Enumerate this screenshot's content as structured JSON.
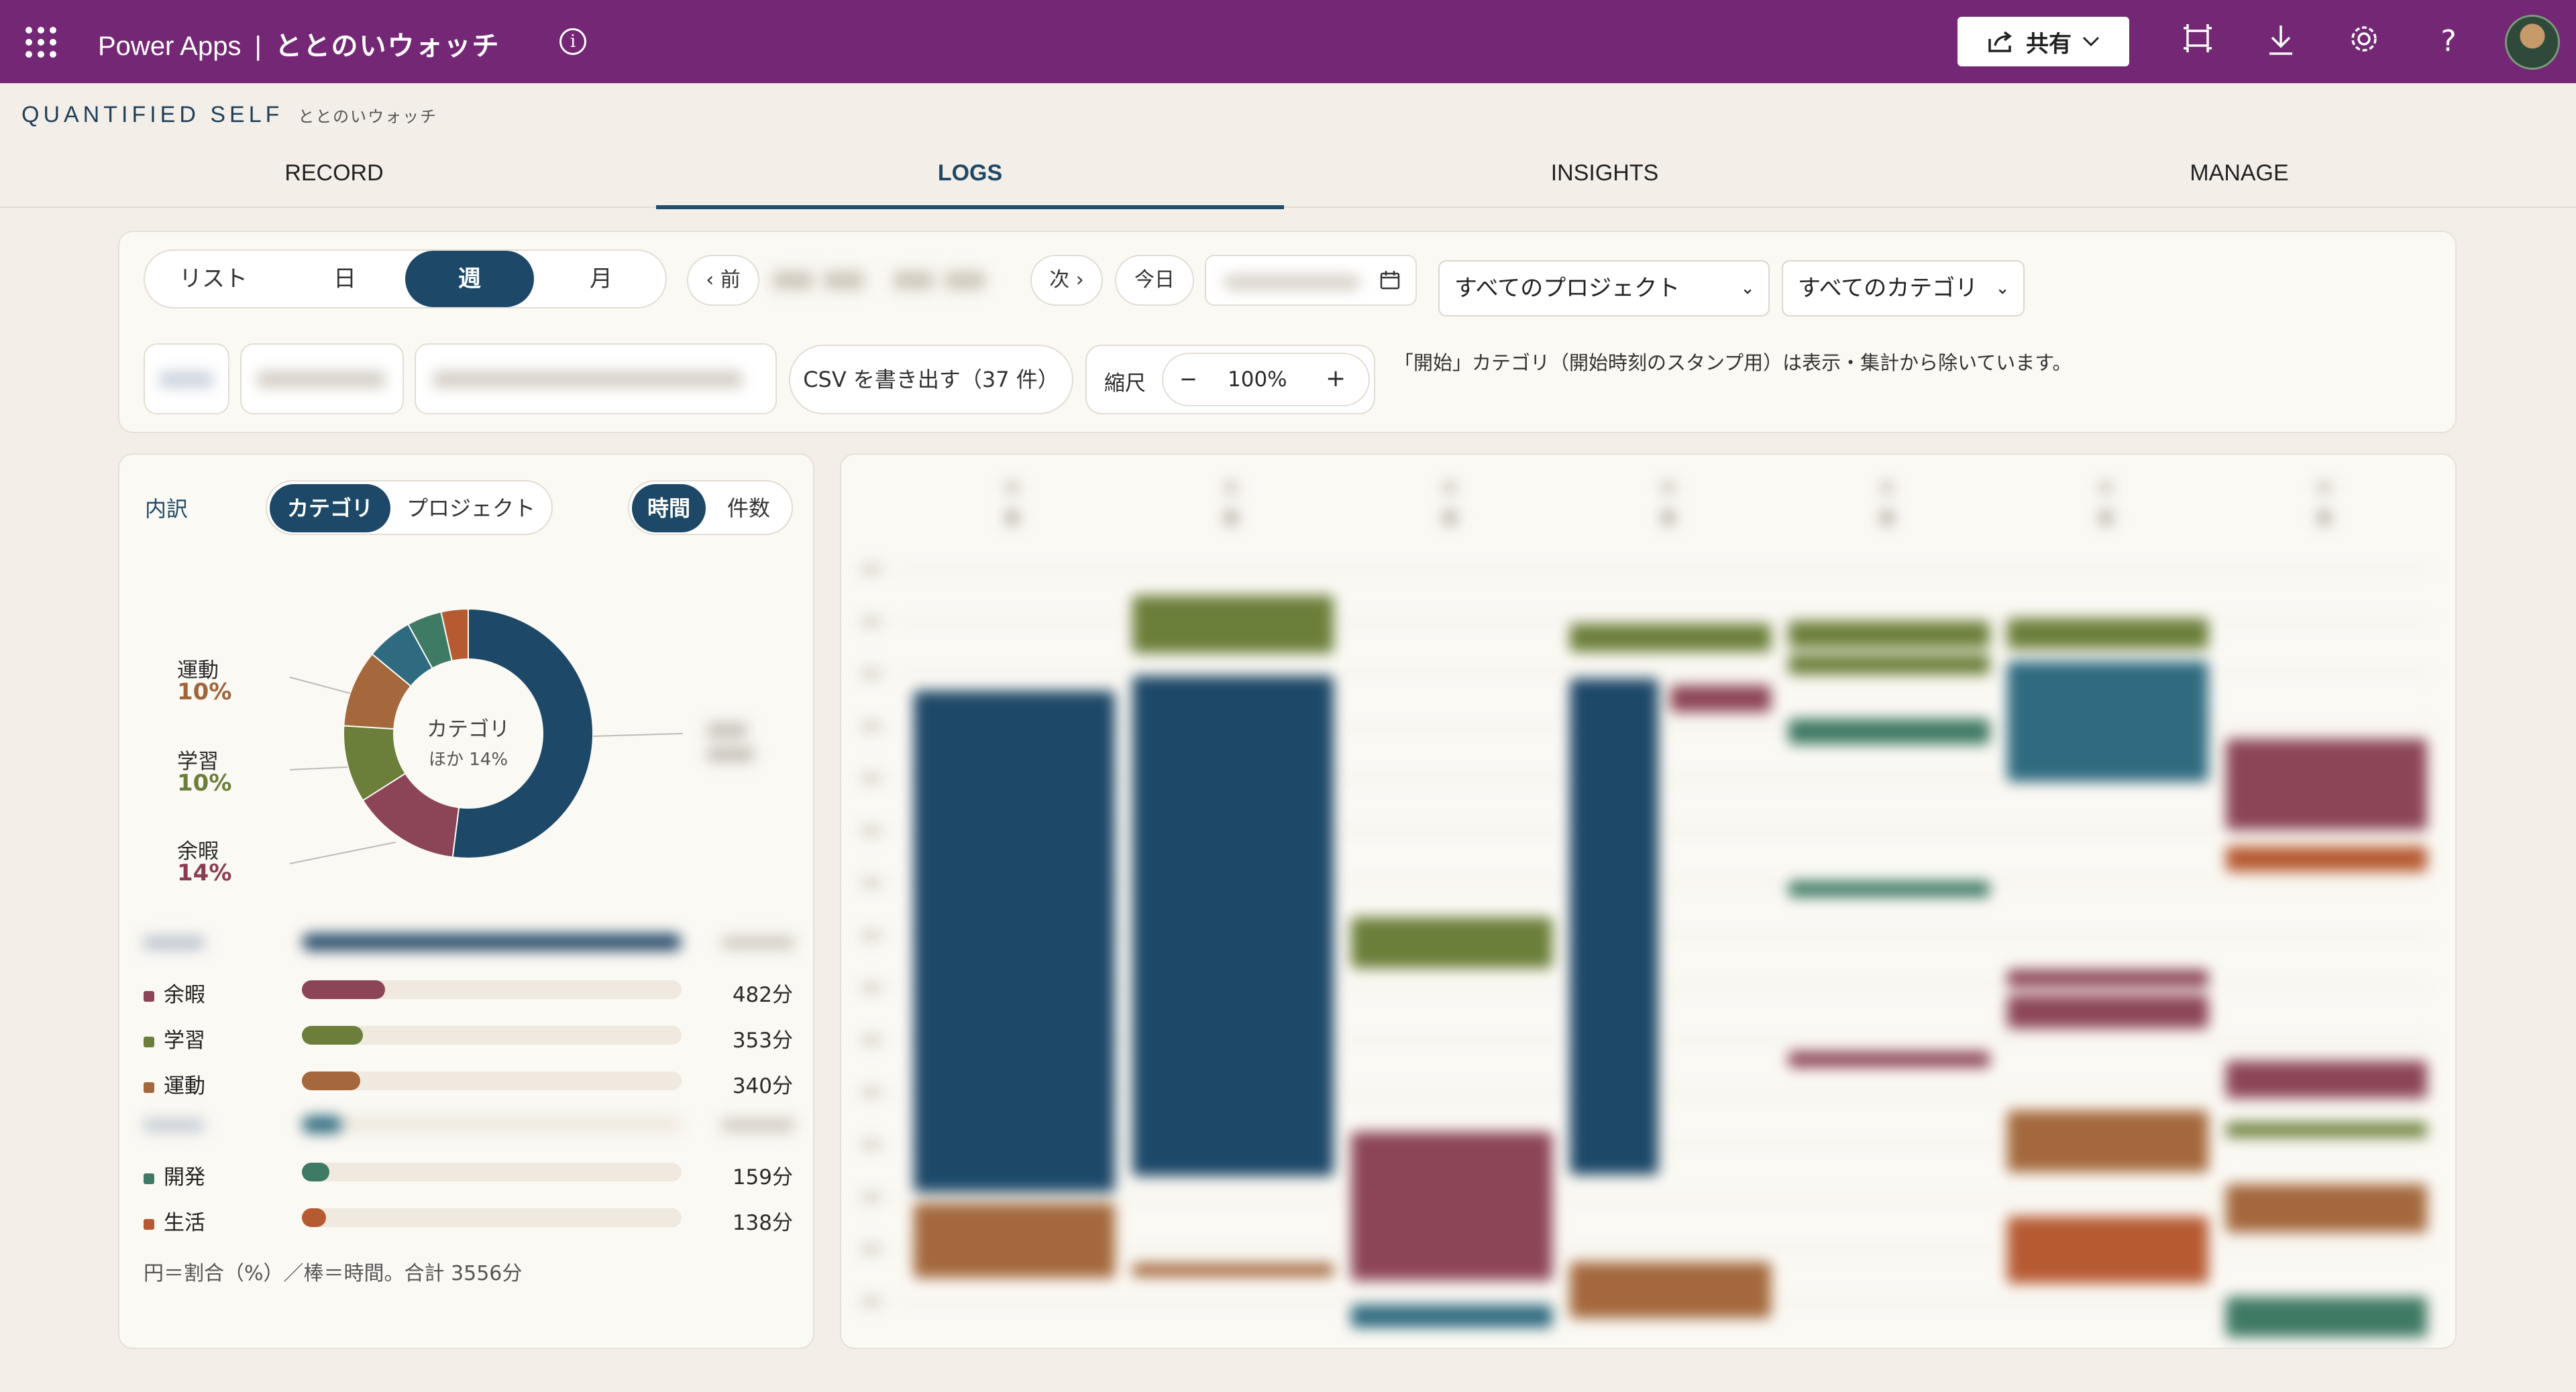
{
  "topbar": {
    "product": "Power Apps",
    "separator": "|",
    "app_name": "ととのいウォッチ",
    "share_label": "共有",
    "icons": [
      "waffle-icon",
      "info-icon",
      "share-icon",
      "fit-screen-icon",
      "download-icon",
      "settings-icon",
      "help-icon",
      "avatar"
    ],
    "color": "#742774"
  },
  "header": {
    "brand": "QUANTIFIED SELF",
    "brand_sub": "ととのいウォッチ"
  },
  "tabs": [
    {
      "label": "RECORD",
      "active": false
    },
    {
      "label": "LOGS",
      "active": true
    },
    {
      "label": "INSIGHTS",
      "active": false
    },
    {
      "label": "MANAGE",
      "active": false
    }
  ],
  "toolbar": {
    "views": [
      "リスト",
      "日",
      "週",
      "月"
    ],
    "active_view": "週",
    "prev_label": "‹ 前",
    "next_label": "次 ›",
    "today_label": "今日",
    "project_select": "すべてのプロジェクト",
    "category_select": "すべてのカテゴリ",
    "csv_label": "CSV を書き出す（37 件）",
    "scale_label": "縮尺",
    "scale_minus": "−",
    "scale_value": "100%",
    "scale_plus": "+",
    "note": "「開始」カテゴリ（開始時刻のスタンプ用）は表示・集計から除いています。"
  },
  "breakdown": {
    "title": "内訳",
    "group_tabs": [
      "カテゴリ",
      "プロジェクト"
    ],
    "group_active": "カテゴリ",
    "metric_tabs": [
      "時間",
      "件数"
    ],
    "metric_active": "時間",
    "donut_center_title": "カテゴリ",
    "donut_center_sub": "ほか 14%",
    "callouts": [
      {
        "name": "運動",
        "pct": "10%",
        "color": "#a0643a"
      },
      {
        "name": "学習",
        "pct": "10%",
        "color": "#6b7f3a"
      },
      {
        "name": "余暇",
        "pct": "14%",
        "color": "#8a3d52"
      }
    ],
    "rows": [
      {
        "name": "余暇",
        "value": "482分",
        "minutes": 482,
        "color": "#8c4556"
      },
      {
        "name": "学習",
        "value": "353分",
        "minutes": 353,
        "color": "#6b7f3a"
      },
      {
        "name": "運動",
        "value": "340分",
        "minutes": 340,
        "color": "#a4683c"
      },
      {
        "name": "開発",
        "value": "159分",
        "minutes": 159,
        "color": "#3f7a64"
      },
      {
        "name": "生活",
        "value": "138分",
        "minutes": 138,
        "color": "#b65a32"
      }
    ],
    "footer": "円＝割合（%）／棒＝時間。合計 3556分"
  },
  "colors": {
    "accent": "#1d4868",
    "leisure": "#8c4556",
    "study": "#6b7f3a",
    "exercise": "#a4683c",
    "dev": "#3f7a64",
    "life": "#b65a32",
    "teal": "#2f6b80"
  }
}
